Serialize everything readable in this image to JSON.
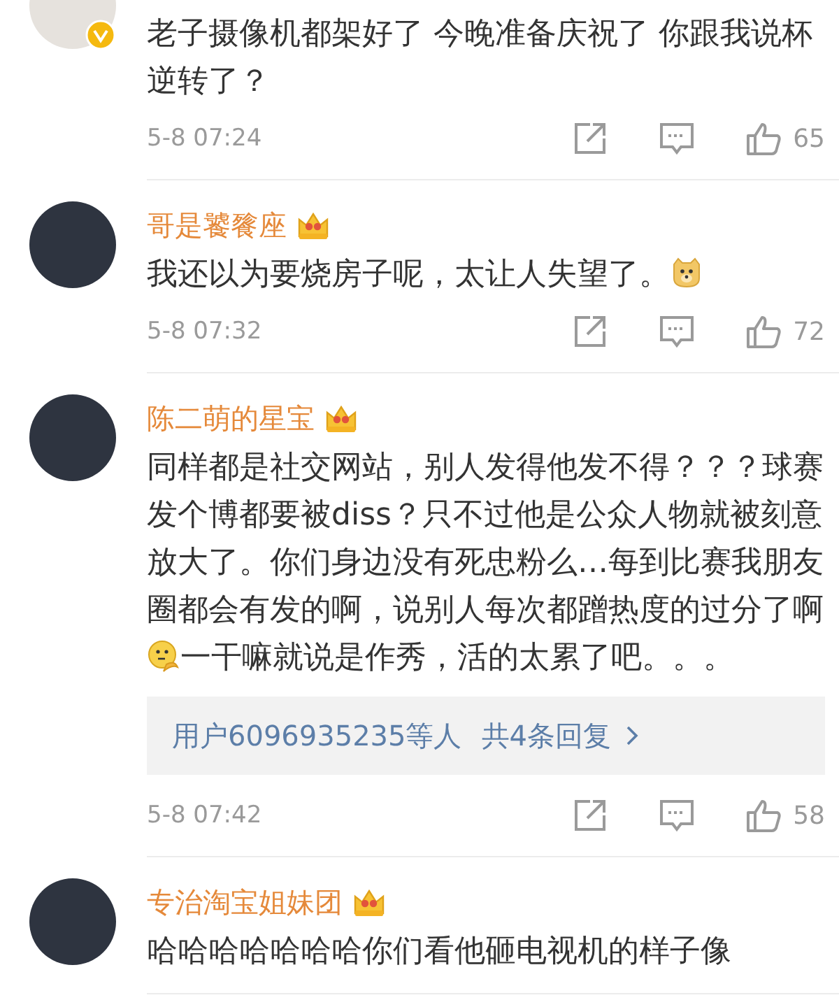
{
  "comments": [
    {
      "avatar": {
        "kind": "cartoon"
      },
      "verified_badge": true,
      "segments": [
        {
          "kind": "text",
          "text": "老子摄像机都架好了 今晚准备庆祝了 你跟我说杯逆转了？"
        }
      ],
      "time": "5-8 07:24",
      "likes": "65"
    },
    {
      "avatar": {
        "kind": "photo"
      },
      "name": "哥是饕餮座",
      "crown_badge": true,
      "segments": [
        {
          "kind": "text",
          "text": "我还以为要烧房子呢，太让人失望了。"
        },
        {
          "kind": "dog-emoji"
        }
      ],
      "time": "5-8 07:32",
      "likes": "72"
    },
    {
      "avatar": {
        "kind": "photo"
      },
      "name": "陈二萌的星宝",
      "crown_badge": true,
      "segments": [
        {
          "kind": "text",
          "text": "同样都是社交网站，别人发得他发不得？？？球赛发个博都要被diss？只不过他是公众人物就被刻意放大了。你们身边没有死忠粉么…每到比赛我朋友圈都会有发的啊，说别人每次都蹭热度的过分了啊"
        },
        {
          "kind": "thinking-emoji"
        },
        {
          "kind": "text",
          "text": "一干嘛就说是作秀，活的太累了吧。。。"
        }
      ],
      "replies": {
        "users": "用户6096935235等人",
        "count": "共4条回复"
      },
      "time": "5-8 07:42",
      "likes": "58"
    },
    {
      "avatar": {
        "kind": "photo"
      },
      "name": "专治淘宝姐妹团",
      "crown_badge": true,
      "segments": [
        {
          "kind": "text",
          "text": "哈哈哈哈哈哈哈你们看他砸电视机的样子像"
        }
      ]
    }
  ]
}
